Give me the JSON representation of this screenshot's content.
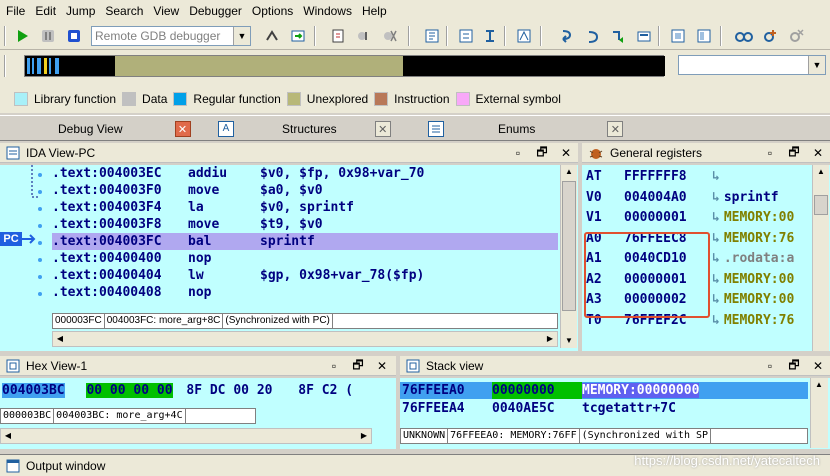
{
  "menu": [
    {
      "label": "File",
      "u": "F",
      "rest": "ile"
    },
    {
      "label": "Edit",
      "u": "E",
      "rest": "dit"
    },
    {
      "label": "Jump",
      "u": "J",
      "rest": "ump"
    },
    {
      "label": "Search",
      "u": "",
      "rest": "Search"
    },
    {
      "label": "View",
      "u": "V",
      "rest": "iew"
    },
    {
      "label": "Debugger",
      "u": "D",
      "rest": "ebugger"
    },
    {
      "label": "Options",
      "u": "O",
      "rest": "ptions"
    },
    {
      "label": "Windows",
      "u": "W",
      "rest": "indows"
    },
    {
      "label": "Help",
      "u": "H",
      "rest": "elp"
    }
  ],
  "toolbar": {
    "debugger_select": "Remote GDB debugger"
  },
  "legend": [
    {
      "label": "Library function",
      "color": "#a8f0f8"
    },
    {
      "label": "Data",
      "color": "#c0c0c0"
    },
    {
      "label": "Regular function",
      "color": "#00a0e8"
    },
    {
      "label": "Unexplored",
      "color": "#b8b878"
    },
    {
      "label": "Instruction",
      "color": "#b87858"
    },
    {
      "label": "External symbol",
      "color": "#f8a8f8"
    }
  ],
  "tabs": [
    {
      "label": "Debug View",
      "icon": "debug-view-icon"
    },
    {
      "label": "Structures",
      "icon": "structures-icon"
    },
    {
      "label": "Enums",
      "icon": "enums-icon"
    }
  ],
  "ida_view": {
    "title": "IDA View-PC",
    "pc_label": "PC",
    "lines": [
      {
        "addr": ".text:004003EC",
        "mn": "addiu",
        "ops": "$v0, $fp, 0x98+var_70",
        "hl": false
      },
      {
        "addr": ".text:004003F0",
        "mn": "move",
        "ops": "$a0, $v0",
        "hl": false
      },
      {
        "addr": ".text:004003F4",
        "mn": "la",
        "ops": "$v0, sprintf",
        "hl": false
      },
      {
        "addr": ".text:004003F8",
        "mn": "move",
        "ops": "$t9, $v0",
        "hl": false
      },
      {
        "addr": ".text:004003FC",
        "mn": "bal",
        "ops": "sprintf",
        "hl": true
      },
      {
        "addr": ".text:00400400",
        "mn": "nop",
        "ops": "",
        "hl": false
      },
      {
        "addr": ".text:00400404",
        "mn": "lw",
        "ops": "$gp, 0x98+var_78($fp)",
        "hl": false
      },
      {
        "addr": ".text:00400408",
        "mn": "nop",
        "ops": "",
        "hl": false
      }
    ],
    "status": [
      "000003FC",
      "004003FC: more_arg+8C",
      "(Synchronized with PC)"
    ]
  },
  "registers": {
    "title": "General registers",
    "rows": [
      {
        "name": "AT",
        "value": "FFFFFFF8",
        "label": "",
        "kind": ""
      },
      {
        "name": "V0",
        "value": "004004A0",
        "label": "sprintf",
        "kind": ""
      },
      {
        "name": "V1",
        "value": "00000001",
        "label": "MEMORY:00",
        "kind": "mem"
      },
      {
        "name": "A0",
        "value": "76FFEEC8",
        "label": "MEMORY:76",
        "kind": "mem"
      },
      {
        "name": "A1",
        "value": "0040CD10",
        "label": ".rodata:a",
        "kind": "ro"
      },
      {
        "name": "A2",
        "value": "00000001",
        "label": "MEMORY:00",
        "kind": "mem"
      },
      {
        "name": "A3",
        "value": "00000002",
        "label": "MEMORY:00",
        "kind": "mem"
      },
      {
        "name": "T0",
        "value": "76FFEF2C",
        "label": "MEMORY:76",
        "kind": "mem"
      }
    ]
  },
  "hex_view": {
    "title": "Hex View-1",
    "addr": "004003BC",
    "bytes_hl": "00 00 00 00",
    "bytes": "8F DC 00 20",
    "bytes2": "8F C2 (",
    "status": [
      "000003BC",
      "004003BC: more_arg+4C"
    ]
  },
  "stack_view": {
    "title": "Stack view",
    "rows": [
      {
        "addr": "76FFEEA0",
        "value": "00000000",
        "label": "MEMORY:00000000",
        "hl": true
      },
      {
        "addr": "76FFEEA4",
        "value": "0040AE5C",
        "label": "tcgetattr+7C",
        "hl": false
      }
    ],
    "status": [
      "UNKNOWN",
      "76FFEEA0: MEMORY:76FF",
      "(Synchronized with SP"
    ]
  },
  "output": {
    "title": "Output window"
  },
  "watermark": "https://blog.csdn.net/yatecaltech"
}
